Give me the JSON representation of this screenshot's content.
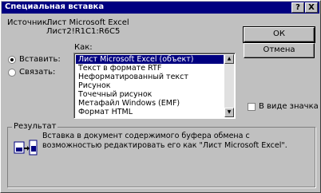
{
  "window": {
    "title": "Специальная вставка",
    "help_label": "?",
    "close_label": "X"
  },
  "source": {
    "label": "Источник:",
    "app": "Лист Microsoft Excel",
    "range": "Лист2!R1C1:R6C5"
  },
  "as_label": "Как:",
  "options": {
    "paste_label": "Вставить:",
    "link_label": "Связать:",
    "paste_selected": true
  },
  "formats": [
    "Лист Microsoft Excel (объект)",
    "Текст в формате RTF",
    "Неформатированный текст",
    "Рисунок",
    "Точечный рисунок",
    "Метафайл Windows (EMF)",
    "Формат HTML"
  ],
  "selected_format_index": 0,
  "buttons": {
    "ok": "ОК",
    "cancel": "Отмена"
  },
  "display_as_icon": {
    "label": "В виде значка",
    "checked": false
  },
  "result": {
    "legend": "Результат",
    "text": "Вставка в документ содержимого буфера обмена с возможностью редактировать его как \"Лист Microsoft Excel\"."
  },
  "icons": {
    "result": "paste-result-icon"
  }
}
